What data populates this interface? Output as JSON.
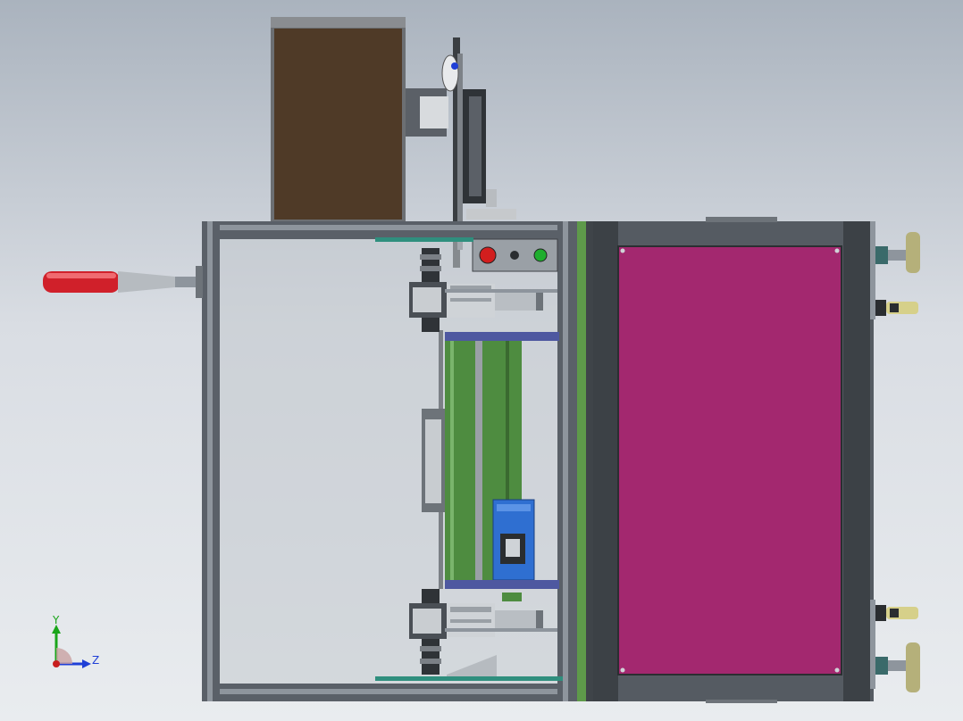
{
  "viewport": {
    "background_top": "#aab3be",
    "background_bottom": "#e9ecef"
  },
  "triad": {
    "y_label": "Y",
    "z_label": "Z",
    "y_color": "#1aa51a",
    "z_color": "#1f3fd6",
    "x_color": "#c81e1e"
  },
  "colors": {
    "frame": "#5a6068",
    "frame_light": "#8e959d",
    "cabinet_panel": "#a3286f",
    "cabinet_frame": "#555b62",
    "box": "#4f3a27",
    "belt": "#4e8c40",
    "motor": "#2f6fd1",
    "handle_grip": "#d0202a",
    "estop": "#d21e1e",
    "button_green": "#1fae2e",
    "green_strip": "#5e9a4a"
  }
}
